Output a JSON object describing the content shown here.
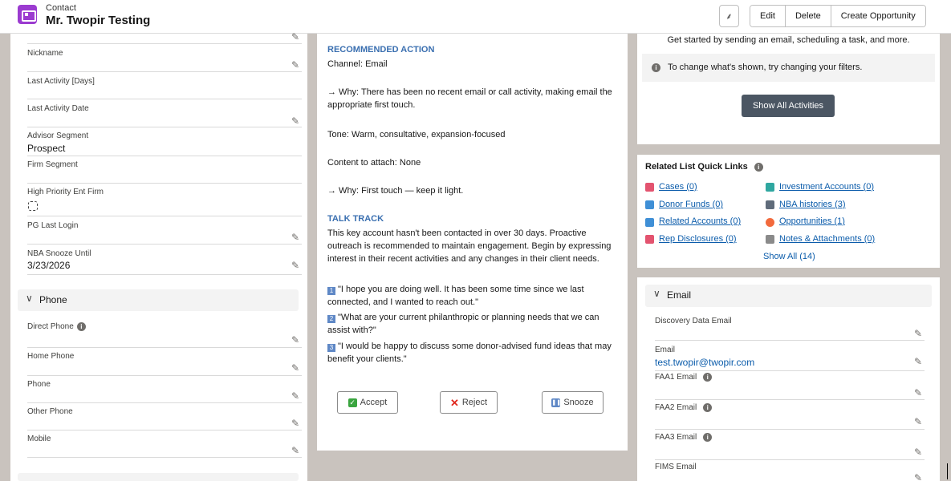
{
  "header": {
    "object_type": "Contact",
    "record_name": "Mr. Twopir Testing",
    "buttons": {
      "edit": "Edit",
      "delete": "Delete",
      "create_opportunity": "Create Opportunity"
    }
  },
  "left_fields": [
    {
      "label": "Nickname",
      "value": ""
    },
    {
      "label": "Last Activity [Days]",
      "value": ""
    },
    {
      "label": "Last Activity Date",
      "value": ""
    },
    {
      "label": "Advisor Segment",
      "value": "Prospect"
    },
    {
      "label": "Firm Segment",
      "value": ""
    },
    {
      "label": "High Priority Ent Firm",
      "value": ""
    },
    {
      "label": "PG Last Login",
      "value": ""
    },
    {
      "label": "NBA Snooze Until",
      "value": "3/23/2026"
    }
  ],
  "phone_section": {
    "title": "Phone",
    "fields": [
      {
        "label": "Direct Phone",
        "value": ""
      },
      {
        "label": "Home Phone",
        "value": ""
      },
      {
        "label": "Phone",
        "value": ""
      },
      {
        "label": "Other Phone",
        "value": ""
      },
      {
        "label": "Mobile",
        "value": ""
      }
    ]
  },
  "recommendation": {
    "heading": "RECOMMENDED ACTION",
    "channel": "Channel: Email",
    "why1": "→ Why: There has been no recent email or call activity, making email the appropriate first touch.",
    "tone": "Tone: Warm, consultative, expansion-focused",
    "content": "Content to attach: None",
    "why2": "→ Why: First touch — keep it light.",
    "talk_heading": "TALK TRACK",
    "talk_body": "This key account hasn't been contacted in over 30 days. Proactive outreach is recommended to maintain engagement. Begin by expressing interest in their recent activities and any changes in their client needs.",
    "quotes": [
      {
        "num": "1",
        "text": "\"I hope you are doing well. It has been some time since we last connected, and I wanted to reach out.\""
      },
      {
        "num": "2",
        "text": "\"What are your current philanthropic or planning needs that we can assist with?\""
      },
      {
        "num": "3",
        "text": "\"I would be happy to discuss some donor-advised fund ideas that may benefit your clients.\""
      }
    ],
    "actions": {
      "accept": "Accept",
      "reject": "Reject",
      "snooze": "Snooze"
    }
  },
  "activity": {
    "prompt": "Get started by sending an email, scheduling a task, and more.",
    "filter_note": "To change what's shown, try changing your filters.",
    "show_all": "Show All Activities"
  },
  "quick_links": {
    "title": "Related List Quick Links",
    "left": [
      {
        "label": "Cases (0)",
        "color": "#e3536f"
      },
      {
        "label": "Donor Funds (0)",
        "color": "#3f8fd6"
      },
      {
        "label": "Related Accounts (0)",
        "color": "#3f8fd6"
      },
      {
        "label": "Rep Disclosures (0)",
        "color": "#e3536f"
      }
    ],
    "right": [
      {
        "label": "Investment Accounts (0)",
        "color": "#2fa7a0"
      },
      {
        "label": "NBA histories (3)",
        "color": "#5f6b7a"
      },
      {
        "label": "Opportunities (1)",
        "color": "#f26a3d"
      },
      {
        "label": "Notes & Attachments (0)",
        "color": "#8a8a8a"
      }
    ],
    "show_all": "Show All (14)"
  },
  "email_section": {
    "title": "Email",
    "fields": [
      {
        "label": "Discovery Data Email",
        "value": ""
      },
      {
        "label": "Email",
        "value": "test.twopir@twopir.com"
      },
      {
        "label": "FAA1 Email",
        "value": ""
      },
      {
        "label": "FAA2 Email",
        "value": ""
      },
      {
        "label": "FAA3 Email",
        "value": ""
      },
      {
        "label": "FIMS Email",
        "value": ""
      }
    ]
  }
}
